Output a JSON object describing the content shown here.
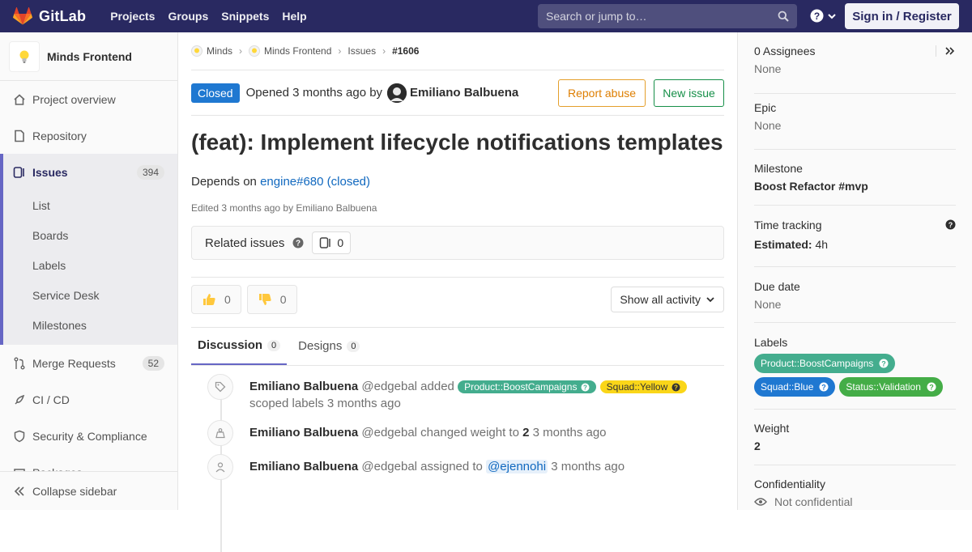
{
  "topbar": {
    "brand": "GitLab",
    "nav": [
      "Projects",
      "Groups",
      "Snippets",
      "Help"
    ],
    "search_placeholder": "Search or jump to…",
    "signin": "Sign in / Register"
  },
  "sidebar": {
    "project_name": "Minds Frontend",
    "items": [
      {
        "label": "Project overview"
      },
      {
        "label": "Repository"
      },
      {
        "label": "Issues",
        "count": "394"
      },
      {
        "label": "Merge Requests",
        "count": "52"
      },
      {
        "label": "CI / CD"
      },
      {
        "label": "Security & Compliance"
      },
      {
        "label": "Packages"
      }
    ],
    "sub_items": [
      "List",
      "Boards",
      "Labels",
      "Service Desk",
      "Milestones"
    ],
    "collapse": "Collapse sidebar"
  },
  "breadcrumb": [
    "Minds",
    "Minds Frontend",
    "Issues",
    "#1606"
  ],
  "issue": {
    "status": "Closed",
    "opened_prefix": "Opened 3 months ago by",
    "author": "Emiliano Balbuena",
    "report_abuse": "Report abuse",
    "new_issue": "New issue",
    "title": "(feat): Implement lifecycle notifications templates",
    "desc_prefix": "Depends on",
    "desc_link": "engine#680 (closed)",
    "edited": "Edited 3 months ago by Emiliano Balbuena",
    "related_label": "Related issues",
    "related_count": "0",
    "thumbs_up": "0",
    "thumbs_down": "0",
    "activity_filter": "Show all activity",
    "tabs": [
      {
        "label": "Discussion",
        "count": "0"
      },
      {
        "label": "Designs",
        "count": "0"
      }
    ]
  },
  "timeline": [
    {
      "user": "Emiliano Balbuena",
      "handle": "@edgebal",
      "action": "added",
      "labels": [
        "Product::BoostCampaigns",
        "Squad::Yellow"
      ],
      "suffix": "scoped labels 3 months ago"
    },
    {
      "user": "Emiliano Balbuena",
      "handle": "@edgebal",
      "action": "changed weight to",
      "value": "2",
      "suffix": "3 months ago"
    },
    {
      "user": "Emiliano Balbuena",
      "handle": "@edgebal",
      "action": "assigned to",
      "mention": "@ejennohi",
      "suffix": "3 months ago"
    }
  ],
  "right": {
    "assignees_title": "0 Assignees",
    "assignees_value": "None",
    "epic_title": "Epic",
    "epic_value": "None",
    "milestone_title": "Milestone",
    "milestone_value": "Boost Refactor #mvp",
    "time_title": "Time tracking",
    "time_label": "Estimated:",
    "time_value": "4h",
    "due_title": "Due date",
    "due_value": "None",
    "labels_title": "Labels",
    "labels": [
      {
        "text": "Product::BoostCampaigns",
        "color": "#44ad8e"
      },
      {
        "text": "Squad::Blue",
        "color": "#1f78d1"
      },
      {
        "text": "Status::Validation",
        "color": "#44ad47"
      }
    ],
    "weight_title": "Weight",
    "weight_value": "2",
    "conf_title": "Confidentiality",
    "conf_value": "Not confidential"
  },
  "colors": {
    "navbar": "#292961",
    "accent": "#6666c4",
    "closed": "#1f78d1",
    "label_boost": "#44ad8e",
    "label_yellow": "#fad619"
  }
}
